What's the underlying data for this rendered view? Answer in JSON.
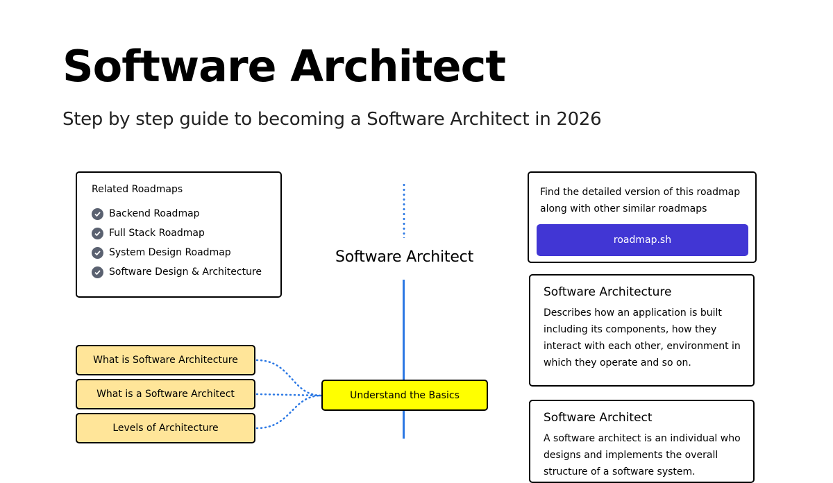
{
  "header": {
    "title": "Software Architect",
    "subtitle": "Step by step guide to becoming a Software Architect in 2026"
  },
  "related": {
    "heading": "Related Roadmaps",
    "items": [
      "Backend Roadmap",
      "Full Stack Roadmap",
      "System Design Roadmap",
      "Software Design & Architecture"
    ]
  },
  "diagram": {
    "center_title": "Software Architect",
    "topics": [
      "What is Software Architecture",
      "What is a Software Architect",
      "Levels of Architecture"
    ],
    "main_topic": "Understand the Basics"
  },
  "info": {
    "text": "Find the detailed version of this roadmap along with other similar roadmaps",
    "button_label": "roadmap.sh"
  },
  "descriptions": [
    {
      "title": "Software Architecture",
      "text": "Describes how an application is built including its components, how they interact with each other, environment in which they operate and so on."
    },
    {
      "title": "Software Architect",
      "text": "A software architect is an individual who designs and implements the overall structure of a software system."
    }
  ],
  "colors": {
    "topic_fill": "#ffe599",
    "main_topic_fill": "#ffff00",
    "connector": "#2b78e4",
    "button": "#4136d4",
    "check": "#5a6170"
  }
}
